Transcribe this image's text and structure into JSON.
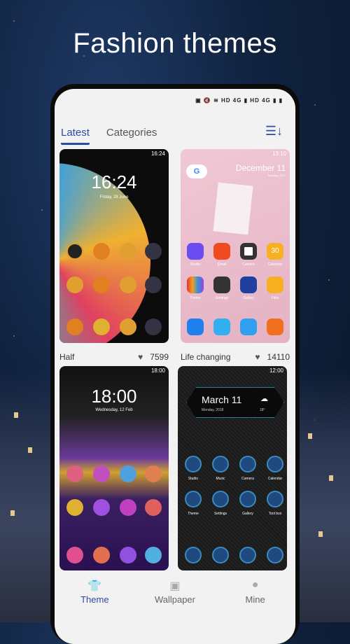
{
  "headline": "Fashion themes",
  "status_bar": {
    "icons": "▣ 🔇 ≋ HD 4G ▮ HD 4G ▮ ▮"
  },
  "tabs": [
    {
      "label": "Latest",
      "active": true
    },
    {
      "label": "Categories",
      "active": false
    }
  ],
  "sort_icon": "sort-icon",
  "themes": [
    {
      "name": "Half",
      "likes": "7599",
      "preview": {
        "time_status": "16:24",
        "clock": "16:24",
        "date": "Friday, 28 June"
      }
    },
    {
      "name": "Life changing",
      "likes": "14110",
      "preview": {
        "time_status": "13:10",
        "date": "December 11",
        "subdate": "Monday, 2017",
        "apps": [
          "Studio",
          "Email",
          "Camera",
          "Calendar",
          "Theme",
          "Settings",
          "Gallery",
          "Files"
        ],
        "calendar_day": "30"
      }
    },
    {
      "name": "",
      "likes": "",
      "preview": {
        "time_status": "18:00",
        "clock": "18:00",
        "date": "Wednesday, 12 Feb"
      }
    },
    {
      "name": "",
      "likes": "",
      "preview": {
        "time_status": "12:00",
        "date": "March 11",
        "subdate": "Monday, 2018",
        "temp": "18°",
        "apps": [
          "Studio",
          "Music",
          "Camera",
          "Calendar",
          "Theme",
          "Settings",
          "Gallery",
          "Tool box"
        ]
      }
    }
  ],
  "bottom_nav": [
    {
      "label": "Theme",
      "icon": "shirt-icon",
      "active": true
    },
    {
      "label": "Wallpaper",
      "icon": "image-icon",
      "active": false
    },
    {
      "label": "Mine",
      "icon": "person-icon",
      "active": false
    }
  ],
  "colors": {
    "accent": "#2d4aa3",
    "screen_bg": "#f2f2f2"
  }
}
